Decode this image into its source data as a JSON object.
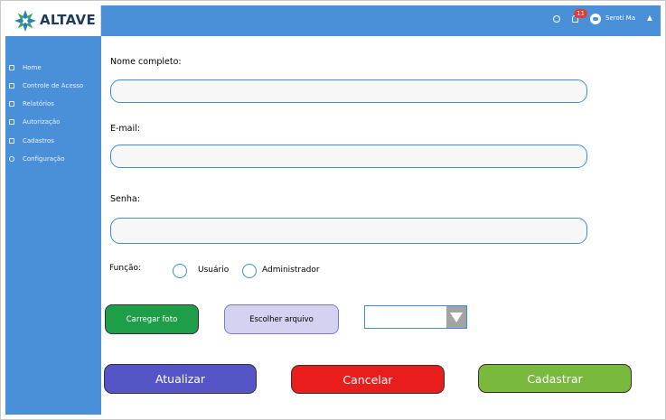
{
  "brand": {
    "name": "ALTAVE"
  },
  "topbar": {
    "notification_count": "11",
    "user_name": "Seroti Ma"
  },
  "sidebar": {
    "items": [
      {
        "label": "Home",
        "icon": "home-icon"
      },
      {
        "label": "Controle de Acesso",
        "icon": "card-icon"
      },
      {
        "label": "Relatórios",
        "icon": "document-icon"
      },
      {
        "label": "Autorização",
        "icon": "checklist-icon"
      },
      {
        "label": "Cadastros",
        "icon": "check-box-icon"
      },
      {
        "label": "Configuração",
        "icon": "gear-icon"
      }
    ]
  },
  "form": {
    "name_label": "Nome completo:",
    "name_value": "",
    "email_label": "E-mail:",
    "email_value": "",
    "password_label": "Senha:",
    "password_value": "",
    "role_label": "Função:",
    "role_options": [
      "Usuário",
      "Administrador"
    ],
    "upload_photo_label": "Carregar foto",
    "choose_file_label": "Escolher arquivo",
    "select_value": ""
  },
  "actions": {
    "update_label": "Atualizar",
    "cancel_label": "Cancelar",
    "register_label": "Cadastrar"
  },
  "colors": {
    "primary_blue": "#4a90d9",
    "upload_green": "#1e9e48",
    "update_purple": "#5655c8",
    "cancel_red": "#ea1d1d",
    "register_green": "#79b93e"
  }
}
